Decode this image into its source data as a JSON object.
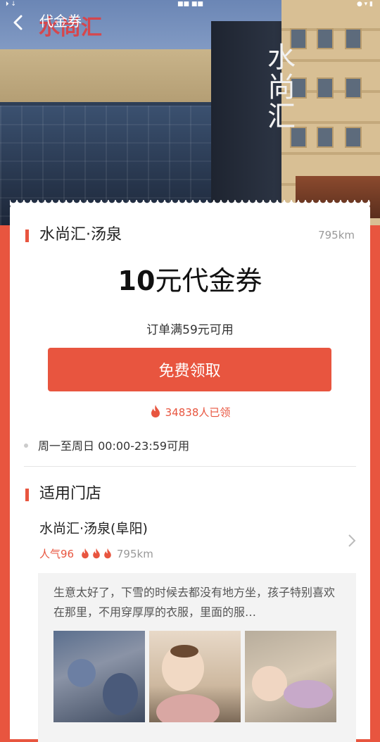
{
  "status_bar": {
    "left": "⏵ ↓",
    "center": "■■ ■■",
    "right": "● ▾ ▮"
  },
  "header": {
    "back_icon": "chevron-left-icon",
    "title": "代金券"
  },
  "hero": {
    "banner_text": "水尚汇",
    "building_sign": "水尚汇"
  },
  "shop": {
    "name": "水尚汇·汤泉",
    "distance": "795km"
  },
  "coupon": {
    "amount": "10",
    "unit_label": "元代金券",
    "condition": "订单满59元可用",
    "button_label": "免费领取",
    "claimed_count": "34838人已领"
  },
  "usage_time": "周一至周日 00:00-23:59可用",
  "stores": {
    "title": "适用门店",
    "items": [
      {
        "name": "水尚汇·汤泉(阜阳)",
        "popularity": "人气96",
        "distance": "795km"
      }
    ]
  },
  "review": {
    "text": "生意太好了，下雪的时候去都没有地方坐，孩子特别喜欢在那里，不用穿厚厚的衣服，里面的服…"
  },
  "colors": {
    "accent": "#e8553f"
  }
}
